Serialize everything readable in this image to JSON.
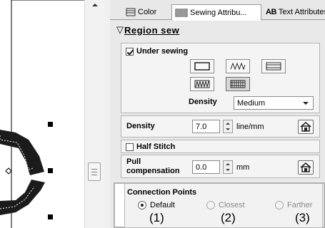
{
  "tabs": [
    {
      "label": "Color",
      "icon": "color-palette-icon"
    },
    {
      "label": "Sewing Attribu...",
      "icon": "sewing-pattern-icon",
      "active": true
    },
    {
      "label": "Text Attributes",
      "icon": "text-ab-icon",
      "prefix": "AB"
    }
  ],
  "region": {
    "header": "Region sew",
    "under_sewing": {
      "label": "Under sewing",
      "checked": true,
      "patterns": [
        "plain-rect",
        "zigzag",
        "horizontal-lines",
        "zigzag-boxed",
        "crosshatch"
      ],
      "selected_pattern": "crosshatch",
      "density_label": "Density",
      "density_value": "Medium"
    },
    "density": {
      "label": "Density",
      "value": "7.0",
      "unit": "line/mm"
    },
    "half_stitch": {
      "label": "Half Stitch",
      "checked": false
    },
    "pull": {
      "label": "Pull compensation",
      "value": "0.0",
      "unit": "mm"
    }
  },
  "connection": {
    "title": "Connection Points",
    "options": [
      {
        "label": "Default",
        "selected": true,
        "callout": "(1)"
      },
      {
        "label": "Closest",
        "selected": false,
        "callout": "(2)"
      },
      {
        "label": "Farther",
        "selected": false,
        "callout": "(3)"
      }
    ]
  }
}
